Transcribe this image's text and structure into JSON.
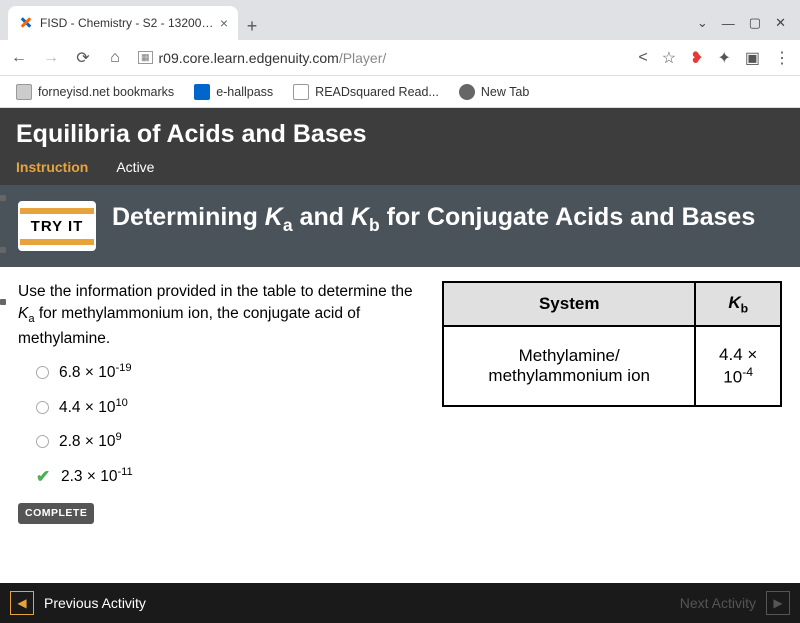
{
  "browser": {
    "tab_title": "FISD - Chemistry - S2 - 132000 -",
    "url_domain": "r09.core.learn.edgenuity.com",
    "url_path": "/Player/",
    "bookmarks": [
      {
        "label": "forneyisd.net bookmarks"
      },
      {
        "label": "e-hallpass"
      },
      {
        "label": "READsquared Read..."
      },
      {
        "label": "New Tab"
      }
    ]
  },
  "page": {
    "title": "Equilibria of Acids and Bases",
    "tab_instruction": "Instruction",
    "tab_active": "Active"
  },
  "section": {
    "tryit": "TRY IT",
    "title_pre": "Determining ",
    "title_ka": "K",
    "title_ka_sub": "a",
    "title_mid": " and ",
    "title_kb": "K",
    "title_kb_sub": "b",
    "title_post": " for Conjugate Acids and Bases"
  },
  "prompt": {
    "part1": "Use the information provided in the table to determine the ",
    "ka": "K",
    "ka_sub": "a",
    "part2": " for methylammonium ion, the conjugate acid of methylamine."
  },
  "choices": [
    {
      "base": "6.8 × 10",
      "exp": "-19",
      "correct": false
    },
    {
      "base": "4.4 × 10",
      "exp": "10",
      "correct": false
    },
    {
      "base": "2.8 × 10",
      "exp": "9",
      "correct": false
    },
    {
      "base": "2.3 × 10",
      "exp": "-11",
      "correct": true
    }
  ],
  "complete": "COMPLETE",
  "table": {
    "h1": "System",
    "h2": "K",
    "h2_sub": "b",
    "row_system": "Methylamine/ methylammonium ion",
    "row_kb_base": "4.4 × 10",
    "row_kb_exp": "-4"
  },
  "footer": {
    "prev": "Previous Activity",
    "next": "Next Activity"
  }
}
